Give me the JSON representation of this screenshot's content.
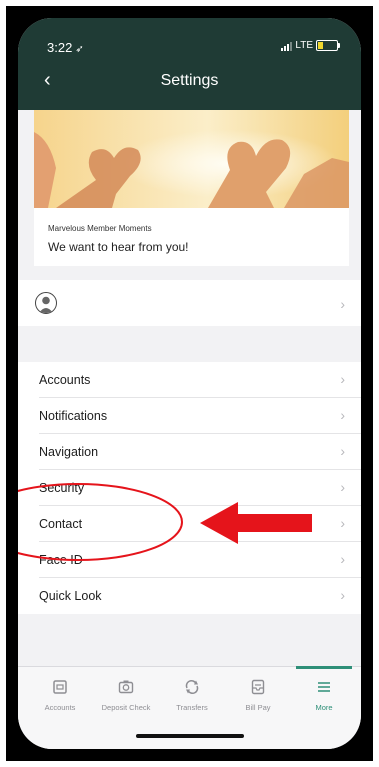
{
  "status_bar": {
    "time": "3:22",
    "location_icon": "location-arrow-icon",
    "network": "LTE",
    "battery_color": "#f0d72e",
    "battery_level_percent": 25
  },
  "nav": {
    "title": "Settings",
    "back_icon": "chevron-left-icon"
  },
  "banner": {
    "caption": "Marvelous Member Moments",
    "heading": "We want to hear from you!"
  },
  "profile": {
    "avatar_icon": "user-avatar-icon"
  },
  "menu_items": [
    {
      "label": "Accounts"
    },
    {
      "label": "Notifications"
    },
    {
      "label": "Navigation"
    },
    {
      "label": "Security"
    },
    {
      "label": "Contact"
    },
    {
      "label": "Face ID"
    },
    {
      "label": "Quick Look"
    }
  ],
  "tab_bar": [
    {
      "label": "Accounts",
      "icon": "accounts-icon",
      "active": false
    },
    {
      "label": "Deposit Check",
      "icon": "camera-icon",
      "active": false
    },
    {
      "label": "Transfers",
      "icon": "transfers-icon",
      "active": false
    },
    {
      "label": "Bill Pay",
      "icon": "bill-pay-icon",
      "active": false
    },
    {
      "label": "More",
      "icon": "menu-icon",
      "active": true
    }
  ],
  "colors": {
    "header_bg": "#1f3b35",
    "accent": "#2e8f78",
    "annotation": "#e5141b"
  },
  "annotation": {
    "target_label": "Contact"
  }
}
